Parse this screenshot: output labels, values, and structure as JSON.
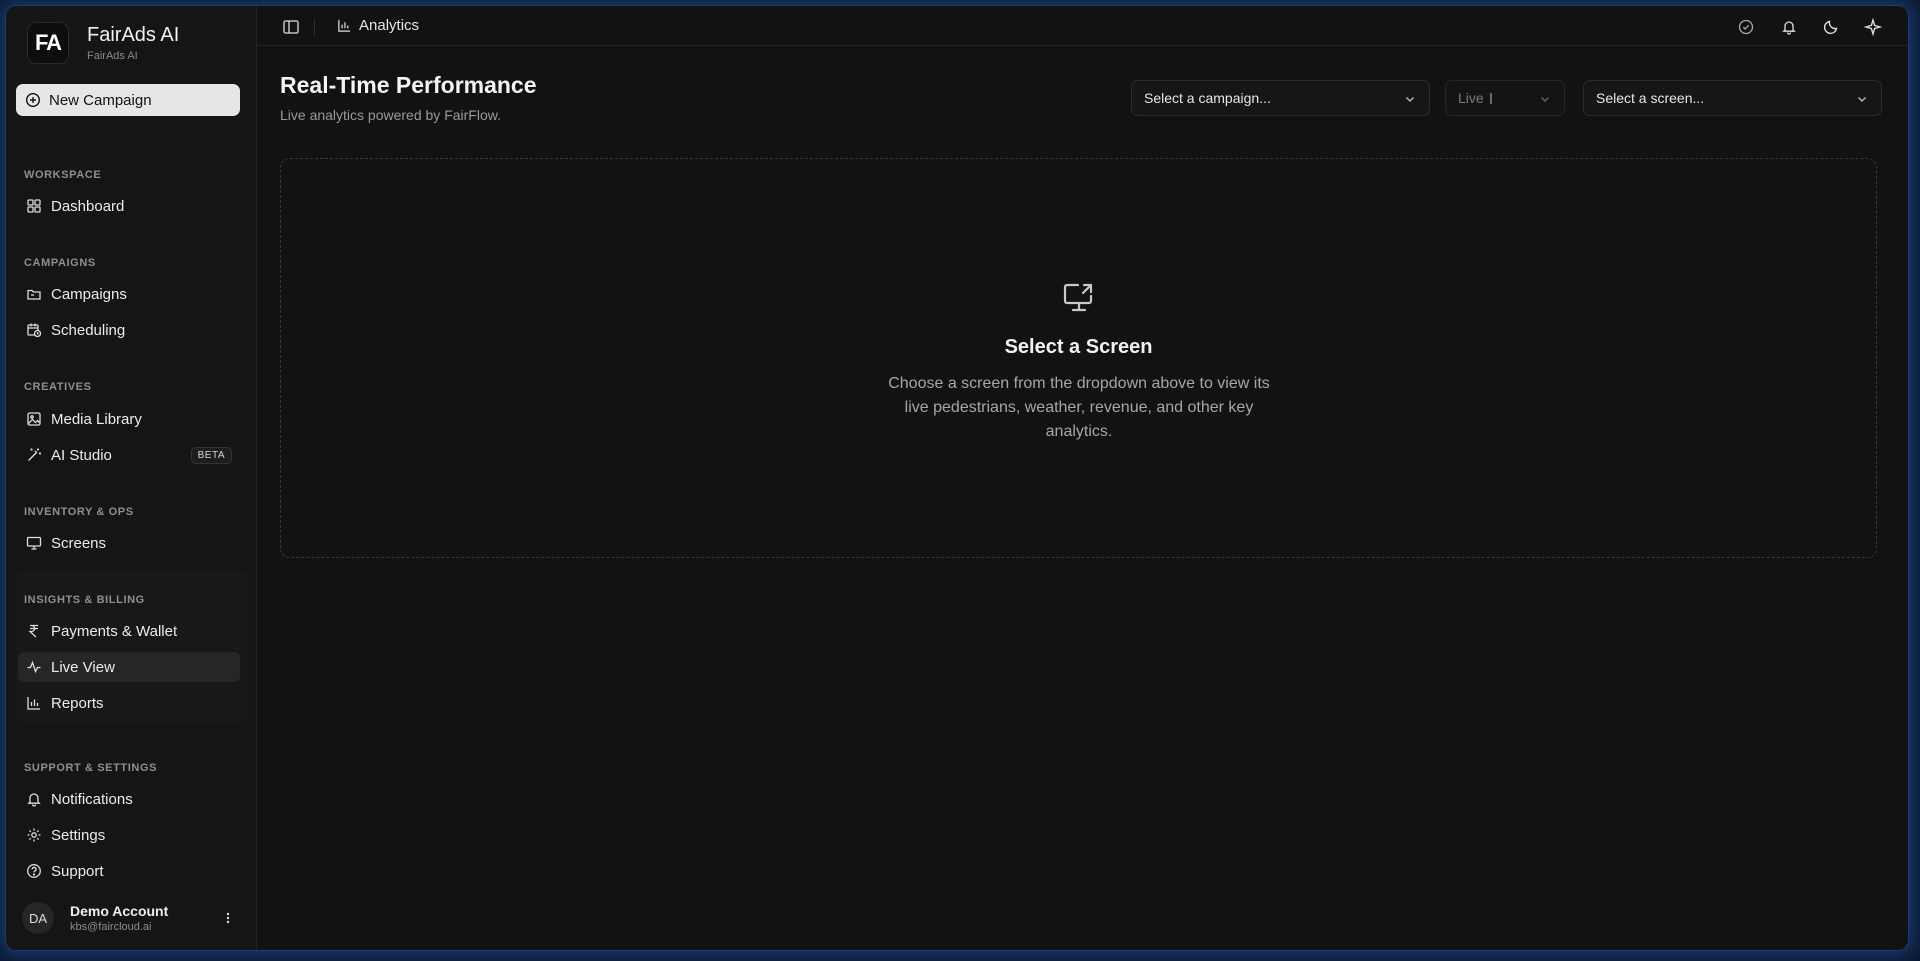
{
  "brand": {
    "logo": "FA",
    "name": "FairAds AI",
    "subtitle": "FairAds AI"
  },
  "new_campaign_label": "New Campaign",
  "sidebar": {
    "sections": [
      {
        "label": "WORKSPACE",
        "items": [
          {
            "label": "Dashboard",
            "icon": "dashboard-icon"
          }
        ]
      },
      {
        "label": "CAMPAIGNS",
        "items": [
          {
            "label": "Campaigns",
            "icon": "folder-icon"
          },
          {
            "label": "Scheduling",
            "icon": "calendar-clock-icon"
          }
        ]
      },
      {
        "label": "CREATIVES",
        "items": [
          {
            "label": "Media Library",
            "icon": "image-icon"
          },
          {
            "label": "AI Studio",
            "icon": "magic-wand-icon",
            "badge": "BETA"
          }
        ]
      },
      {
        "label": "INVENTORY & OPS",
        "items": [
          {
            "label": "Screens",
            "icon": "monitor-icon"
          }
        ]
      },
      {
        "label": "INSIGHTS & BILLING",
        "items": [
          {
            "label": "Payments & Wallet",
            "icon": "rupee-icon"
          },
          {
            "label": "Live View",
            "icon": "activity-icon",
            "active": true
          },
          {
            "label": "Reports",
            "icon": "bar-chart-icon"
          }
        ]
      },
      {
        "label": "SUPPORT & SETTINGS",
        "items": [
          {
            "label": "Notifications",
            "icon": "bell-icon"
          },
          {
            "label": "Settings",
            "icon": "gear-icon"
          },
          {
            "label": "Support",
            "icon": "help-circle-icon"
          }
        ]
      }
    ]
  },
  "account": {
    "initials": "DA",
    "name": "Demo Account",
    "email": "kbs@faircloud.ai"
  },
  "topbar": {
    "breadcrumb": "Analytics"
  },
  "header": {
    "title": "Real-Time Performance",
    "subtitle": "Live analytics powered by FairFlow."
  },
  "filters": {
    "campaign_placeholder": "Select a campaign...",
    "mode": "Live",
    "screen_placeholder": "Select a screen..."
  },
  "empty_state": {
    "title": "Select a Screen",
    "description": "Choose a screen from the dropdown above to view its live pedestrians, weather, revenue, and other key analytics."
  },
  "colors": {
    "background": "#121212",
    "sidebar": "#151515",
    "accent_button": "#e6e6e6",
    "active_item": "#262626"
  }
}
